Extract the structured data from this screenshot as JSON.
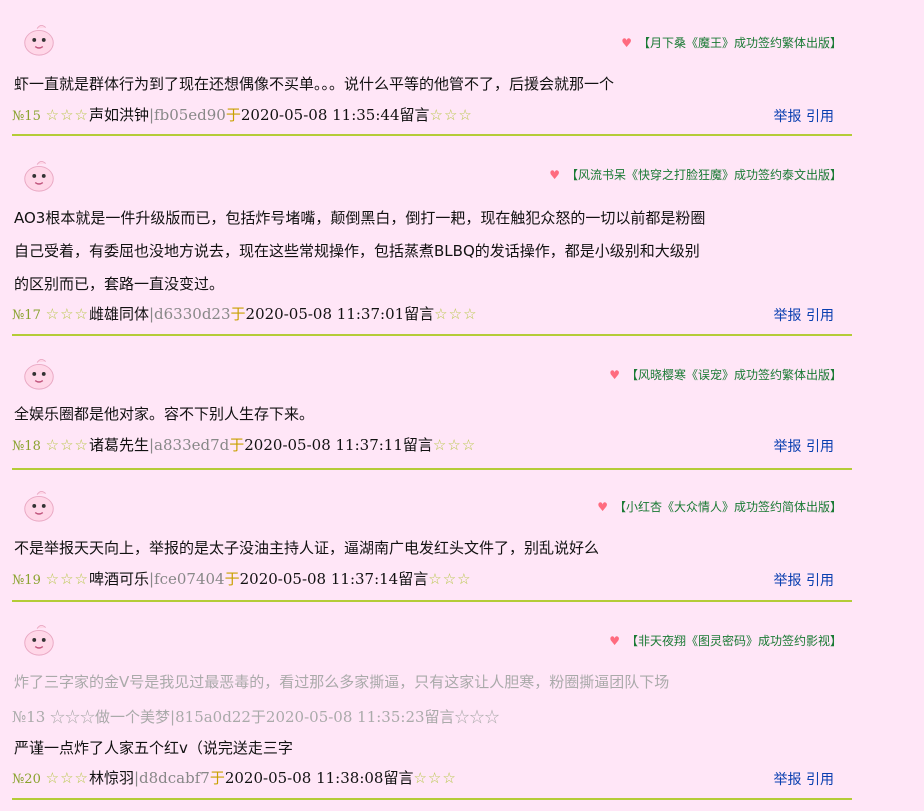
{
  "posts": [
    {
      "promo": "【月下桑《魔王》成功签约繁体出版】",
      "lines": [
        "虾一直就是群体行为到了现在还想偶像不买单。。。说什么平等的他管不了，后援会就那一个"
      ],
      "num": "№15",
      "stars1": "☆☆☆",
      "name": "声如洪钟",
      "hash": "|fb05ed90",
      "yu": "于",
      "time": "2020-05-08 11:35:44",
      "liu": "留言",
      "stars2": "☆☆☆",
      "report": "举报",
      "quote": "引用"
    },
    {
      "promo": "【风流书呆《快穿之打脸狂魔》成功签约泰文出版】",
      "lines": [
        "AO3根本就是一件升级版而已，包括炸号堵嘴，颠倒黑白，倒打一耙，现在触犯众怒的一切以前都是粉圈",
        "自己受着，有委屈也没地方说去，现在这些常规操作，包括蒸煮BLBQ的发话操作，都是小级别和大级别",
        "的区别而已，套路一直没变过。"
      ],
      "num": "№17",
      "stars1": "☆☆☆",
      "name": "雌雄同体",
      "hash": "|d6330d23",
      "yu": "于",
      "time": "2020-05-08 11:37:01",
      "liu": "留言",
      "stars2": "☆☆☆",
      "report": "举报",
      "quote": "引用"
    },
    {
      "promo": "【风晓樱寒《误宠》成功签约繁体出版】",
      "lines": [
        "全娱乐圈都是他对家。容不下别人生存下来。"
      ],
      "num": "№18",
      "stars1": "☆☆☆",
      "name": "诸葛先生",
      "hash": "|a833ed7d",
      "yu": "于",
      "time": "2020-05-08 11:37:11",
      "liu": "留言",
      "stars2": "☆☆☆",
      "report": "举报",
      "quote": "引用"
    },
    {
      "promo": "【小红杏《大众情人》成功签约简体出版】",
      "lines": [
        "不是举报天天向上，举报的是太子没油主持人证，逼湖南广电发红头文件了，别乱说好么"
      ],
      "num": "№19",
      "stars1": "☆☆☆",
      "name": "啤酒可乐",
      "hash": "|fce07404",
      "yu": "于",
      "time": "2020-05-08 11:37:14",
      "liu": "留言",
      "stars2": "☆☆☆",
      "report": "举报",
      "quote": "引用"
    },
    {
      "promo": "【非天夜翔《图灵密码》成功签约影视】",
      "quote_block": {
        "line": "炸了三字家的金V号是我见过最恶毒的，看过那么多家撕逼，只有这家让人胆寒，粉圈撕逼团队下场",
        "meta": "№13 ☆☆☆做一个美梦|815a0d22于2020-05-08 11:35:23留言☆☆☆"
      },
      "lines": [
        "严谨一点炸了人家五个红v（说完送走三字"
      ],
      "num": "№20",
      "stars1": "☆☆☆",
      "name": "林惊羽",
      "hash": "|d8dcabf7",
      "yu": "于",
      "time": "2020-05-08 11:38:08",
      "liu": "留言",
      "stars2": "☆☆☆",
      "report": "举报",
      "quote": "引用"
    }
  ]
}
